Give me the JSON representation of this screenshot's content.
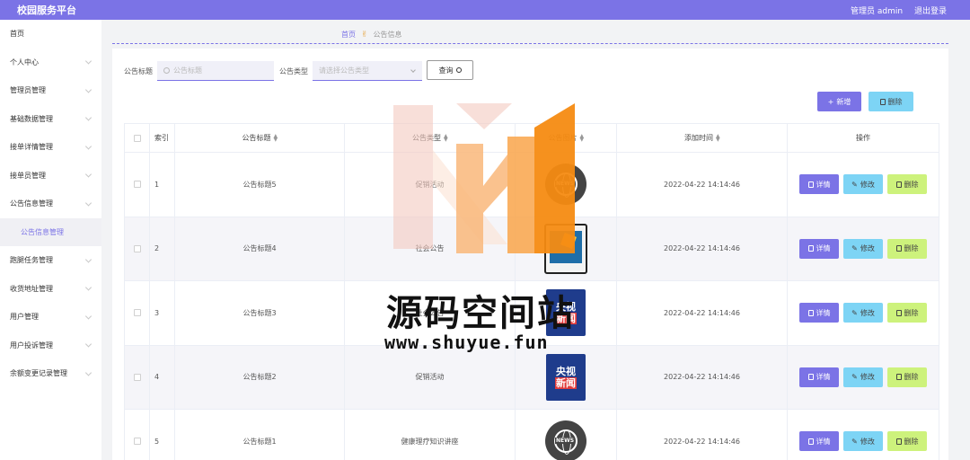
{
  "header": {
    "title": "校园服务平台",
    "admin": "管理员 admin",
    "logout": "退出登录"
  },
  "sidebar": {
    "items": [
      {
        "label": "首页",
        "chevron": false
      },
      {
        "label": "个人中心",
        "chevron": true
      },
      {
        "label": "管理员管理",
        "chevron": true
      },
      {
        "label": "基础数据管理",
        "chevron": true
      },
      {
        "label": "接单详情管理",
        "chevron": true
      },
      {
        "label": "接单员管理",
        "chevron": true
      },
      {
        "label": "公告信息管理",
        "chevron": true
      },
      {
        "label": "公告信息管理",
        "chevron": false,
        "sub": true
      },
      {
        "label": "跑腿任务管理",
        "chevron": true
      },
      {
        "label": "收货地址管理",
        "chevron": true
      },
      {
        "label": "用户管理",
        "chevron": true
      },
      {
        "label": "用户投诉管理",
        "chevron": true
      },
      {
        "label": "余额变更记录管理",
        "chevron": true
      }
    ]
  },
  "breadcrumb": {
    "home": "首页",
    "current": "公告信息"
  },
  "search": {
    "title_label": "公告标题",
    "title_placeholder": "公告标题",
    "type_label": "公告类型",
    "type_placeholder": "请选择公告类型",
    "query_label": "查询"
  },
  "actions": {
    "add": "新增",
    "delete": "删除"
  },
  "table": {
    "headers": [
      "索引",
      "公告标题",
      "公告类型",
      "公告图片",
      "添加时间",
      "操作"
    ],
    "rows": [
      {
        "index": "1",
        "title": "公告标题5",
        "type": "促销活动",
        "image": "news-globe",
        "time": "2022-04-22 14:14:46"
      },
      {
        "index": "2",
        "title": "公告标题4",
        "type": "社会公告",
        "image": "phone-news",
        "time": "2022-04-22 14:14:46"
      },
      {
        "index": "3",
        "title": "公告标题3",
        "type": "社会公告",
        "image": "cctv-news",
        "time": "2022-04-22 14:14:46"
      },
      {
        "index": "4",
        "title": "公告标题2",
        "type": "促销活动",
        "image": "cctv-news",
        "time": "2022-04-22 14:14:46"
      },
      {
        "index": "5",
        "title": "公告标题1",
        "type": "健康理疗知识讲座",
        "image": "news-globe",
        "time": "2022-04-22 14:14:46"
      }
    ],
    "row_actions": {
      "detail": "详情",
      "edit": "修改",
      "delete": "删除"
    }
  },
  "watermark": {
    "text": "源码空间站",
    "url": "www.shuyue.fun"
  },
  "colors": {
    "primary": "#7b73e6",
    "cyan": "#7dd4f5",
    "lime": "#cdf27c"
  }
}
